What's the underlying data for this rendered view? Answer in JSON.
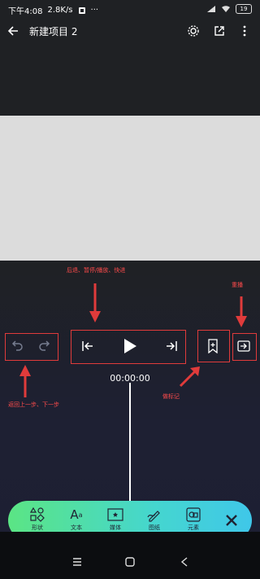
{
  "status": {
    "time": "下午4:08",
    "speed": "2.8K/s",
    "battery": "19"
  },
  "appbar": {
    "title": "新建项目 2"
  },
  "annotations": {
    "transport": "后退、暂停/播放、快进",
    "repeat": "重播",
    "undo_redo": "返回上一步、下一步",
    "bookmark": "做标记"
  },
  "timeline": {
    "time": "00:00:00"
  },
  "toolbar": {
    "items": [
      {
        "label": "形状",
        "icon": "shapes-icon"
      },
      {
        "label": "文本",
        "icon": "text-icon"
      },
      {
        "label": "媒体",
        "icon": "media-icon"
      },
      {
        "label": "图纸",
        "icon": "drawing-icon"
      },
      {
        "label": "元素",
        "icon": "elements-icon"
      }
    ]
  },
  "colors": {
    "annotation": "#ff4b4b",
    "toolbar_gradient_start": "#5be584",
    "toolbar_gradient_end": "#3fc7e9"
  }
}
